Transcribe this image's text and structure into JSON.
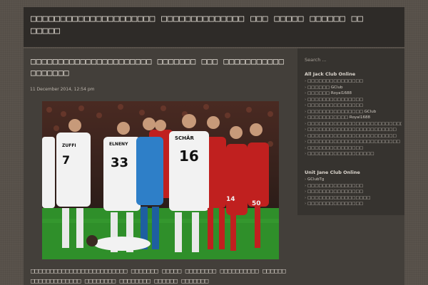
{
  "header": {
    "site_title": "□□□□□□□□□□□□□□□□□□□□□ □□□□□□□□□□□□□□ □□□ □□□□□ □□□□□□ □□□□□□□"
  },
  "post": {
    "title": "□□□□□□□□□□□□□□□□□□□□□□ □□□□□□□ □□□ □□□□□□□□□□□□□□□□□□",
    "date": "11 December 2014, 12:54 pm",
    "image_caption": {
      "players": [
        {
          "name": "ZUFFI",
          "number": "7"
        },
        {
          "name": "ELNENY",
          "number": "33"
        },
        {
          "name": "SCHÄR",
          "number": "16"
        },
        {
          "name": "",
          "number": "14"
        },
        {
          "name": "",
          "number": "50"
        }
      ]
    },
    "excerpt": "□□□□□□□□□□□□□□□□□□□□□□□□□ □□□□□□□ □□□□□ □□□□□□□□ □□□□□□□□□□ □□□□□□□□□□□□□□□□□□□ □□□□□□□□ □□□□□□□□ □□□□□□ □□□□□□□"
  },
  "sidebar": {
    "search_placeholder": "Search ...",
    "widgets": [
      {
        "title": "All Jack Club Online",
        "items": [
          "□□□□□□□□□□□□□□□",
          "□□□□□□ GClub",
          "□□□□□□ Royal1688",
          "□□□□□□□□□□□□□□□",
          "□□□□□□□□□□□□□□□",
          "□□□□□□□□□□□□□□□ GClub",
          "□□□□□□□□□□□ Royal1688",
          "□□□□□□□□□□□□□□□□□□□□□□□□□□",
          "□□□□□□□□□□□□□□□□□□□□□□□□",
          "□□□□□□□□□□□□□□□□□□□□□□□□",
          "□□□□□□□□□□□□□□□□□□□□□□□□□",
          "□□□□□□□□□□□□□□□",
          "□□□□□□□□□□□□□□□□□□"
        ]
      },
      {
        "title": "Unit Jane Club Online",
        "items": [
          "GClubTg",
          "□□□□□□□□□□□□□□□",
          "□□□□□□□□□□□□□□□",
          "□□□□□□□□□□□□□□□□□",
          "□□□□□□□□□□□□□□□"
        ]
      }
    ]
  },
  "colors": {
    "page_bg": "#5a534c",
    "header_bg": "#2e2b28",
    "content_bg": "#433f3a",
    "sidebar_bg": "#36332f",
    "pitch_green": "#2f8f2a",
    "home_red": "#c0201f"
  }
}
